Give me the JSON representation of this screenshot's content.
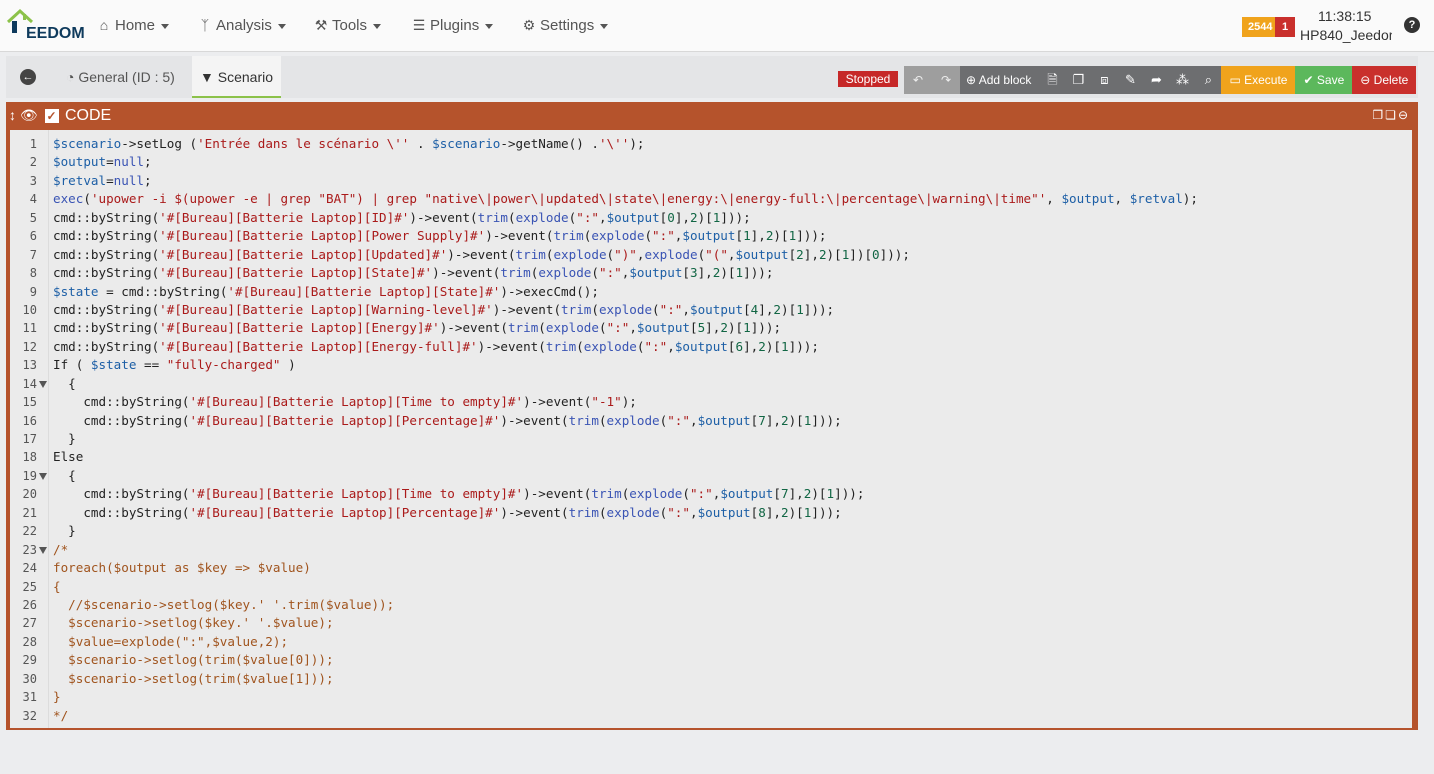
{
  "app": {
    "logo_text": "EEDOM"
  },
  "nav": {
    "items": [
      {
        "label": "Home",
        "icon": "home-icon"
      },
      {
        "label": "Analysis",
        "icon": "stethoscope-icon"
      },
      {
        "label": "Tools",
        "icon": "wrench-icon"
      },
      {
        "label": "Plugins",
        "icon": "tasks-icon"
      },
      {
        "label": "Settings",
        "icon": "gear-icon"
      }
    ],
    "badge_orange": "2544",
    "badge_red": "1",
    "clock": "11:38:15",
    "hostname": "HP840_Jeedom",
    "help": "?"
  },
  "tabs": {
    "general": "General (ID : 5)",
    "scenario": "Scenario"
  },
  "toolbar": {
    "status": "Stopped",
    "add_block": "Add block",
    "execute": "Execute",
    "save": "Save",
    "delete": "Delete"
  },
  "colors": {
    "panel": "#b5532c",
    "stopped": "#c62828",
    "execute": "#f0a31c",
    "save": "#5cb85c",
    "delete": "#c9302c"
  },
  "block": {
    "title": "CODE",
    "lines": [
      "$scenario->setLog ('Entrée dans le scénario \\'' . $scenario->getName() .'\\'');",
      "$output=null;",
      "$retval=null;",
      "exec('upower -i $(upower -e | grep \"BAT\") | grep \"native\\|power\\|updated\\|state\\|energy:\\|energy-full:\\|percentage\\|warning\\|time\"', $output, $retval);",
      "cmd::byString('#[Bureau][Batterie Laptop][ID]#')->event(trim(explode(\":\",$output[0],2)[1]));",
      "cmd::byString('#[Bureau][Batterie Laptop][Power Supply]#')->event(trim(explode(\":\",$output[1],2)[1]));",
      "cmd::byString('#[Bureau][Batterie Laptop][Updated]#')->event(trim(explode(\")\",explode(\"(\",$output[2],2)[1])[0]));",
      "cmd::byString('#[Bureau][Batterie Laptop][State]#')->event(trim(explode(\":\",$output[3],2)[1]));",
      "$state = cmd::byString('#[Bureau][Batterie Laptop][State]#')->execCmd();",
      "cmd::byString('#[Bureau][Batterie Laptop][Warning-level]#')->event(trim(explode(\":\",$output[4],2)[1]));",
      "cmd::byString('#[Bureau][Batterie Laptop][Energy]#')->event(trim(explode(\":\",$output[5],2)[1]));",
      "cmd::byString('#[Bureau][Batterie Laptop][Energy-full]#')->event(trim(explode(\":\",$output[6],2)[1]));",
      "If ( $state == \"fully-charged\" )",
      "  {",
      "    cmd::byString('#[Bureau][Batterie Laptop][Time to empty]#')->event(\"-1\");",
      "    cmd::byString('#[Bureau][Batterie Laptop][Percentage]#')->event(trim(explode(\":\",$output[7],2)[1]));",
      "  }",
      "Else",
      "  {",
      "    cmd::byString('#[Bureau][Batterie Laptop][Time to empty]#')->event(trim(explode(\":\",$output[7],2)[1]));",
      "    cmd::byString('#[Bureau][Batterie Laptop][Percentage]#')->event(trim(explode(\":\",$output[8],2)[1]));",
      "  }",
      "/*",
      "foreach($output as $key => $value)",
      "{",
      "  //$scenario->setlog($key.' '.trim($value));",
      "  $scenario->setlog($key.' '.$value);",
      "  $value=explode(\":\",$value,2);",
      "  $scenario->setlog(trim($value[0]));",
      "  $scenario->setlog(trim($value[1]));",
      "}",
      "*/"
    ],
    "fold_lines": [
      14,
      19,
      23
    ],
    "comment_from": 23
  }
}
